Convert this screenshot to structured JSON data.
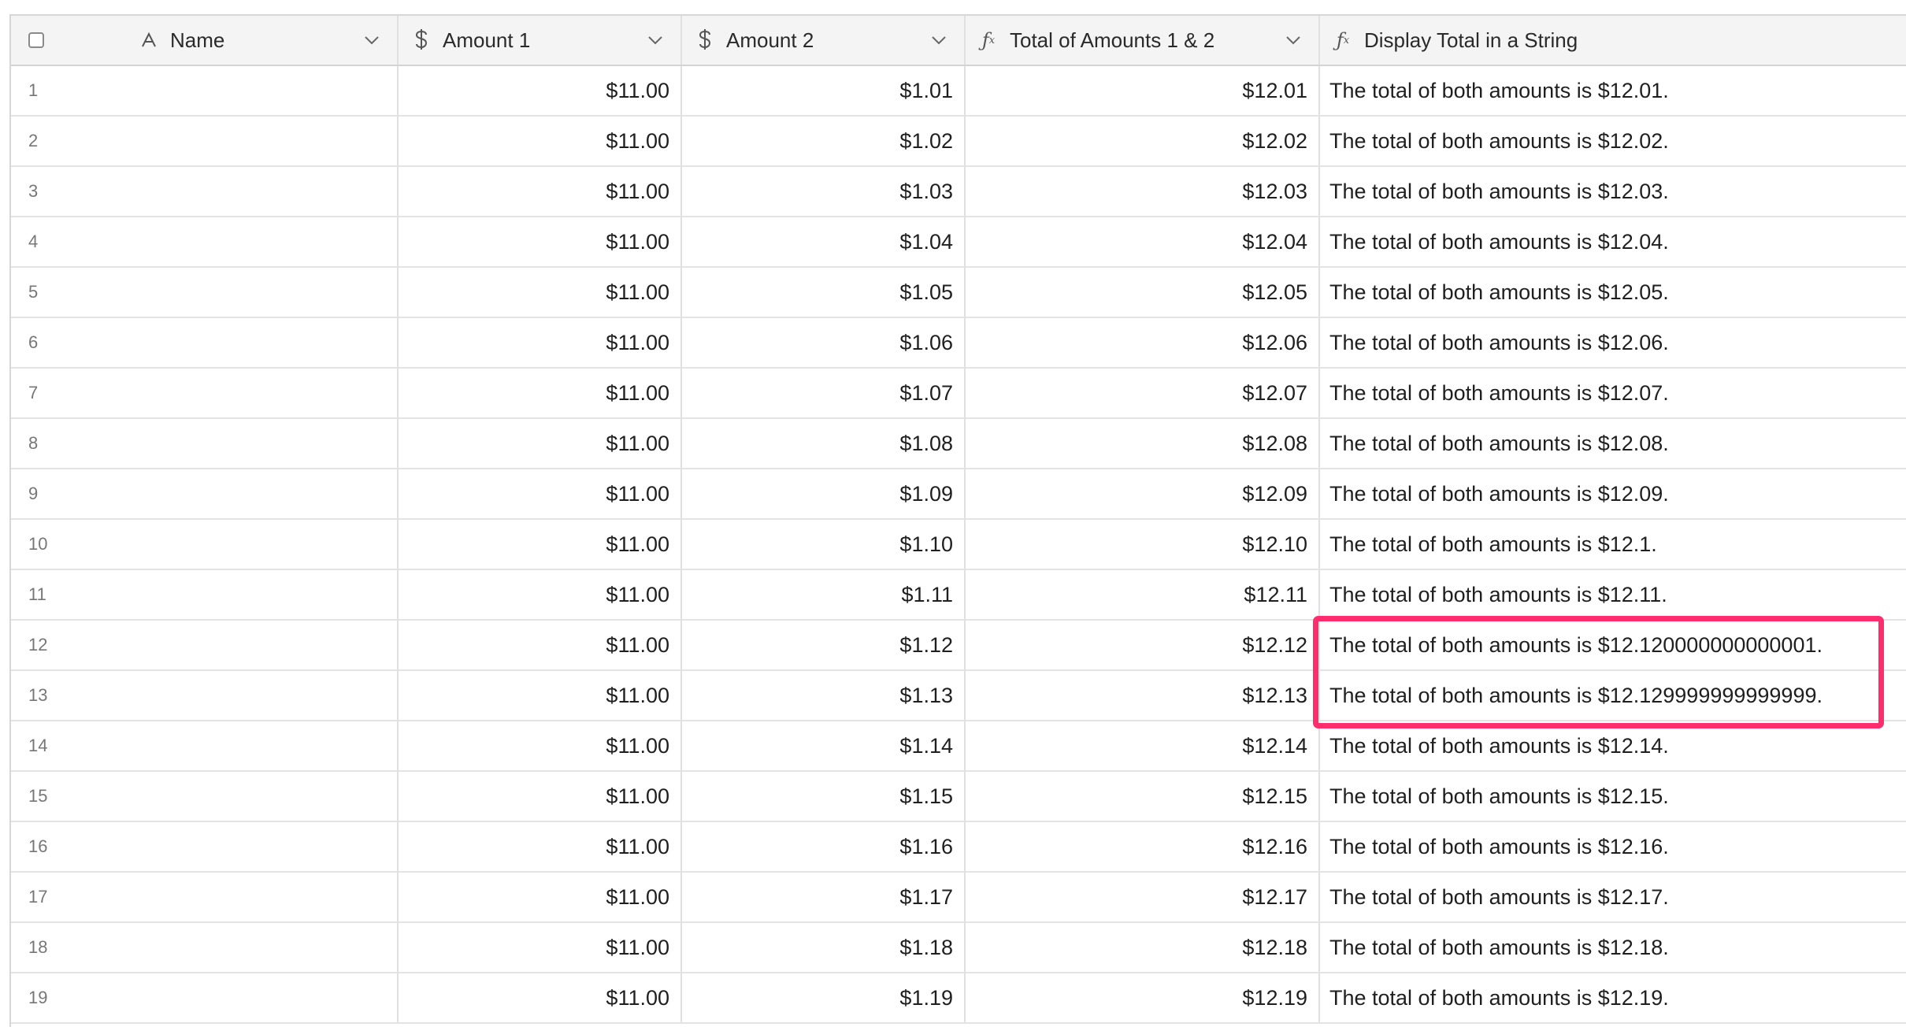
{
  "table": {
    "columns": [
      {
        "label": "Name",
        "icon": "text-type-icon"
      },
      {
        "label": "Amount 1",
        "icon": "dollar-icon"
      },
      {
        "label": "Amount 2",
        "icon": "dollar-icon"
      },
      {
        "label": "Total of Amounts 1 & 2",
        "icon": "formula-icon"
      },
      {
        "label": "Display Total in a String",
        "icon": "formula-icon"
      }
    ],
    "rows": [
      {
        "num": "1",
        "a1": "$11.00",
        "a2": "$1.01",
        "total": "$12.01",
        "display": "The total of both amounts is $12.01."
      },
      {
        "num": "2",
        "a1": "$11.00",
        "a2": "$1.02",
        "total": "$12.02",
        "display": "The total of both amounts is $12.02."
      },
      {
        "num": "3",
        "a1": "$11.00",
        "a2": "$1.03",
        "total": "$12.03",
        "display": "The total of both amounts is $12.03."
      },
      {
        "num": "4",
        "a1": "$11.00",
        "a2": "$1.04",
        "total": "$12.04",
        "display": "The total of both amounts is $12.04."
      },
      {
        "num": "5",
        "a1": "$11.00",
        "a2": "$1.05",
        "total": "$12.05",
        "display": "The total of both amounts is $12.05."
      },
      {
        "num": "6",
        "a1": "$11.00",
        "a2": "$1.06",
        "total": "$12.06",
        "display": "The total of both amounts is $12.06."
      },
      {
        "num": "7",
        "a1": "$11.00",
        "a2": "$1.07",
        "total": "$12.07",
        "display": "The total of both amounts is $12.07."
      },
      {
        "num": "8",
        "a1": "$11.00",
        "a2": "$1.08",
        "total": "$12.08",
        "display": "The total of both amounts is $12.08."
      },
      {
        "num": "9",
        "a1": "$11.00",
        "a2": "$1.09",
        "total": "$12.09",
        "display": "The total of both amounts is $12.09."
      },
      {
        "num": "10",
        "a1": "$11.00",
        "a2": "$1.10",
        "total": "$12.10",
        "display": "The total of both amounts is $12.1."
      },
      {
        "num": "11",
        "a1": "$11.00",
        "a2": "$1.11",
        "total": "$12.11",
        "display": "The total of both amounts is $12.11."
      },
      {
        "num": "12",
        "a1": "$11.00",
        "a2": "$1.12",
        "total": "$12.12",
        "display": "The total of both amounts is $12.120000000000001."
      },
      {
        "num": "13",
        "a1": "$11.00",
        "a2": "$1.13",
        "total": "$12.13",
        "display": "The total of both amounts is $12.129999999999999."
      },
      {
        "num": "14",
        "a1": "$11.00",
        "a2": "$1.14",
        "total": "$12.14",
        "display": "The total of both amounts is $12.14."
      },
      {
        "num": "15",
        "a1": "$11.00",
        "a2": "$1.15",
        "total": "$12.15",
        "display": "The total of both amounts is $12.15."
      },
      {
        "num": "16",
        "a1": "$11.00",
        "a2": "$1.16",
        "total": "$12.16",
        "display": "The total of both amounts is $12.16."
      },
      {
        "num": "17",
        "a1": "$11.00",
        "a2": "$1.17",
        "total": "$12.17",
        "display": "The total of both amounts is $12.17."
      },
      {
        "num": "18",
        "a1": "$11.00",
        "a2": "$1.18",
        "total": "$12.18",
        "display": "The total of both amounts is $12.18."
      },
      {
        "num": "19",
        "a1": "$11.00",
        "a2": "$1.19",
        "total": "$12.19",
        "display": "The total of both amounts is $12.19."
      }
    ]
  },
  "highlight": {
    "color": "#ff2d6e",
    "rows": [
      "12",
      "13"
    ]
  }
}
